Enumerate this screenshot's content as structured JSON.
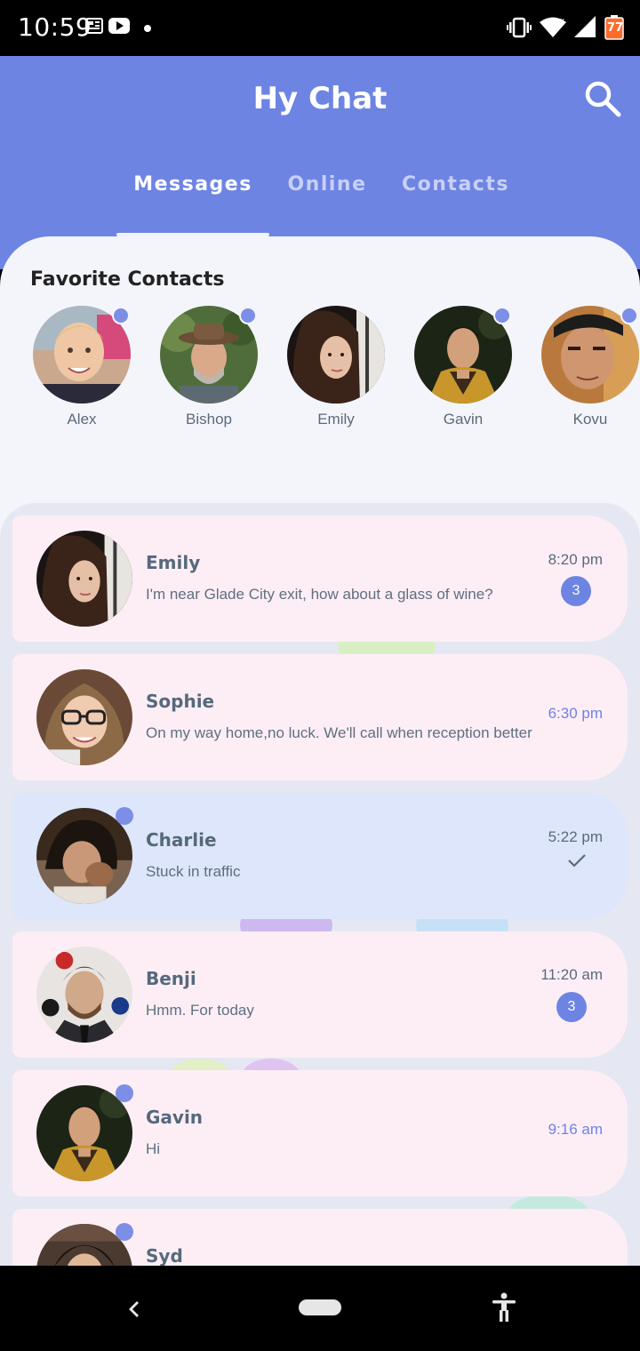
{
  "status_bar": {
    "time": "10:59",
    "battery_level": "77",
    "left_icons": [
      "news-icon",
      "youtube-icon",
      "dot-icon"
    ],
    "right_icons": [
      "vibrate-icon",
      "wifi-icon",
      "signal-icon",
      "battery-icon"
    ]
  },
  "header": {
    "title": "Hy Chat",
    "search_icon": "search-icon",
    "color": "#6d84e3"
  },
  "tabs": [
    {
      "label": "Messages",
      "active": true
    },
    {
      "label": "Online",
      "active": false
    },
    {
      "label": "Contacts",
      "active": false
    }
  ],
  "favorites": {
    "title": "Favorite Contacts",
    "contacts": [
      {
        "name": "Alex",
        "online": true
      },
      {
        "name": "Bishop",
        "online": true
      },
      {
        "name": "Emily",
        "online": false
      },
      {
        "name": "Gavin",
        "online": true
      },
      {
        "name": "Kovu",
        "online": true
      }
    ]
  },
  "chats": [
    {
      "name": "Emily",
      "message": "I'm near Glade City exit, how about a glass of wine?",
      "time": "8:20 pm",
      "unread": "3",
      "online": false,
      "read": false
    },
    {
      "name": "Sophie",
      "message": "On my way home,no luck. We'll call when reception better",
      "time": "6:30 pm",
      "unread": "",
      "online": false,
      "read": false
    },
    {
      "name": "Charlie",
      "message": "Stuck in traffic",
      "time": "5:22 pm",
      "unread": "",
      "online": true,
      "read": true
    },
    {
      "name": "Benji",
      "message": "Hmm. For today",
      "time": "11:20 am",
      "unread": "3",
      "online": false,
      "read": false
    },
    {
      "name": "Gavin",
      "message": "Hi",
      "time": "9:16 am",
      "unread": "",
      "online": true,
      "read": false
    },
    {
      "name": "Syd",
      "message": "",
      "time": "",
      "unread": "",
      "online": true,
      "read": false
    }
  ],
  "nav_bar": {
    "icons": [
      "back-icon",
      "home-pill-icon",
      "accessibility-icon"
    ]
  },
  "colors": {
    "accent": "#6d84e3",
    "card_pink": "#fdeef6",
    "card_blue": "#dde6fa"
  }
}
